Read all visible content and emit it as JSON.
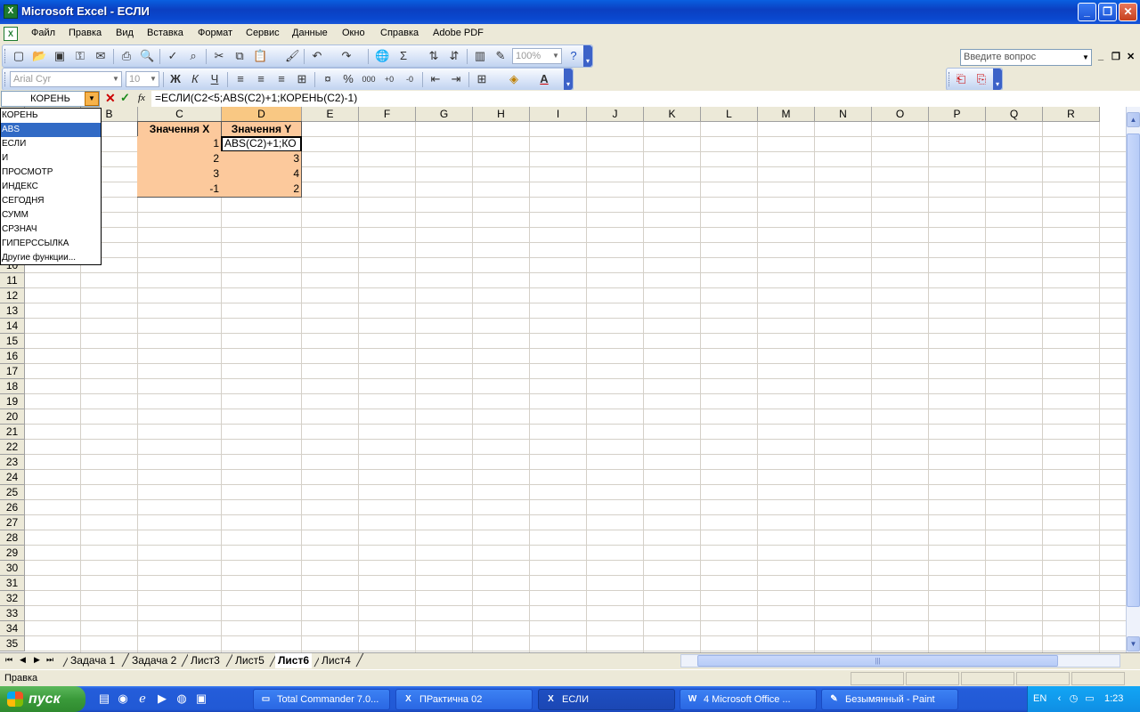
{
  "window": {
    "title": "Microsoft Excel - ЕСЛИ",
    "app_icon": "excel-icon",
    "btn_min": "_",
    "btn_max": "❐",
    "btn_close": "✕"
  },
  "menu": {
    "items": [
      "Файл",
      "Правка",
      "Вид",
      "Вставка",
      "Формат",
      "Сервис",
      "Данные",
      "Окно",
      "Справка",
      "Adobe PDF"
    ],
    "help_placeholder": "Введите вопрос",
    "doc_min": "_",
    "doc_restore": "❐",
    "doc_close": "✕"
  },
  "toolbar_std": {
    "zoom": "100%"
  },
  "toolbar_fmt": {
    "font": "Arial Cyr",
    "size": "10"
  },
  "formula": {
    "name_box": "КОРЕНЬ",
    "cancel": "✕",
    "enter": "✓",
    "fx": "fx",
    "text": "=ЕСЛИ(C2<5;ABS(C2)+1;КОРЕНЬ(C2)-1)"
  },
  "function_list": {
    "items": [
      "КОРЕНЬ",
      "ABS",
      "ЕСЛИ",
      "И",
      "ПРОСМОТР",
      "ИНДЕКС",
      "СЕГОДНЯ",
      "СУММ",
      "СРЗНАЧ",
      "ГИПЕРССЫЛКА",
      "Другие функции..."
    ],
    "selected_index": 1
  },
  "grid": {
    "columns": [
      "A",
      "B",
      "C",
      "D",
      "E",
      "F",
      "G",
      "H",
      "I",
      "J",
      "K",
      "L",
      "M",
      "N",
      "O",
      "P",
      "Q",
      "R"
    ],
    "selected_column": "D",
    "rows": [
      "1",
      "2",
      "3",
      "4",
      "5",
      "6",
      "7",
      "8",
      "9",
      "10",
      "11",
      "12",
      "13",
      "14",
      "15",
      "16",
      "17",
      "18",
      "19",
      "20",
      "21",
      "22",
      "23",
      "24",
      "25",
      "26",
      "27",
      "28",
      "29",
      "30",
      "31",
      "32",
      "33",
      "34",
      "35"
    ],
    "cells": {
      "C1": "Значення X",
      "D1": "Значення Y",
      "C2": "1",
      "D2": "ABS(C2)+1;КО",
      "C3": "2",
      "D3": "3",
      "C4": "3",
      "D4": "4",
      "C5": "-1",
      "D5": "2"
    }
  },
  "sheet_tabs": {
    "tabs": [
      "Задача 1",
      "Задача 2",
      "Лист3",
      "Лист5",
      "Лист6",
      "Лист4"
    ],
    "active": "Лист6",
    "nav": [
      "⏮",
      "◀",
      "▶",
      "⏭"
    ]
  },
  "status": {
    "text": "Правка"
  },
  "taskbar": {
    "start": "пуск",
    "buttons": [
      {
        "label": "Total Commander 7.0...",
        "icon": "▭"
      },
      {
        "label": "ПРактична 02",
        "icon": "X"
      },
      {
        "label": "ЕСЛИ",
        "icon": "X"
      },
      {
        "label": "4 Microsoft Office ...",
        "icon": "W"
      },
      {
        "label": "Безымянный - Paint",
        "icon": "✎"
      }
    ],
    "active_index": 2,
    "lang": "EN",
    "clock": "1:23"
  }
}
